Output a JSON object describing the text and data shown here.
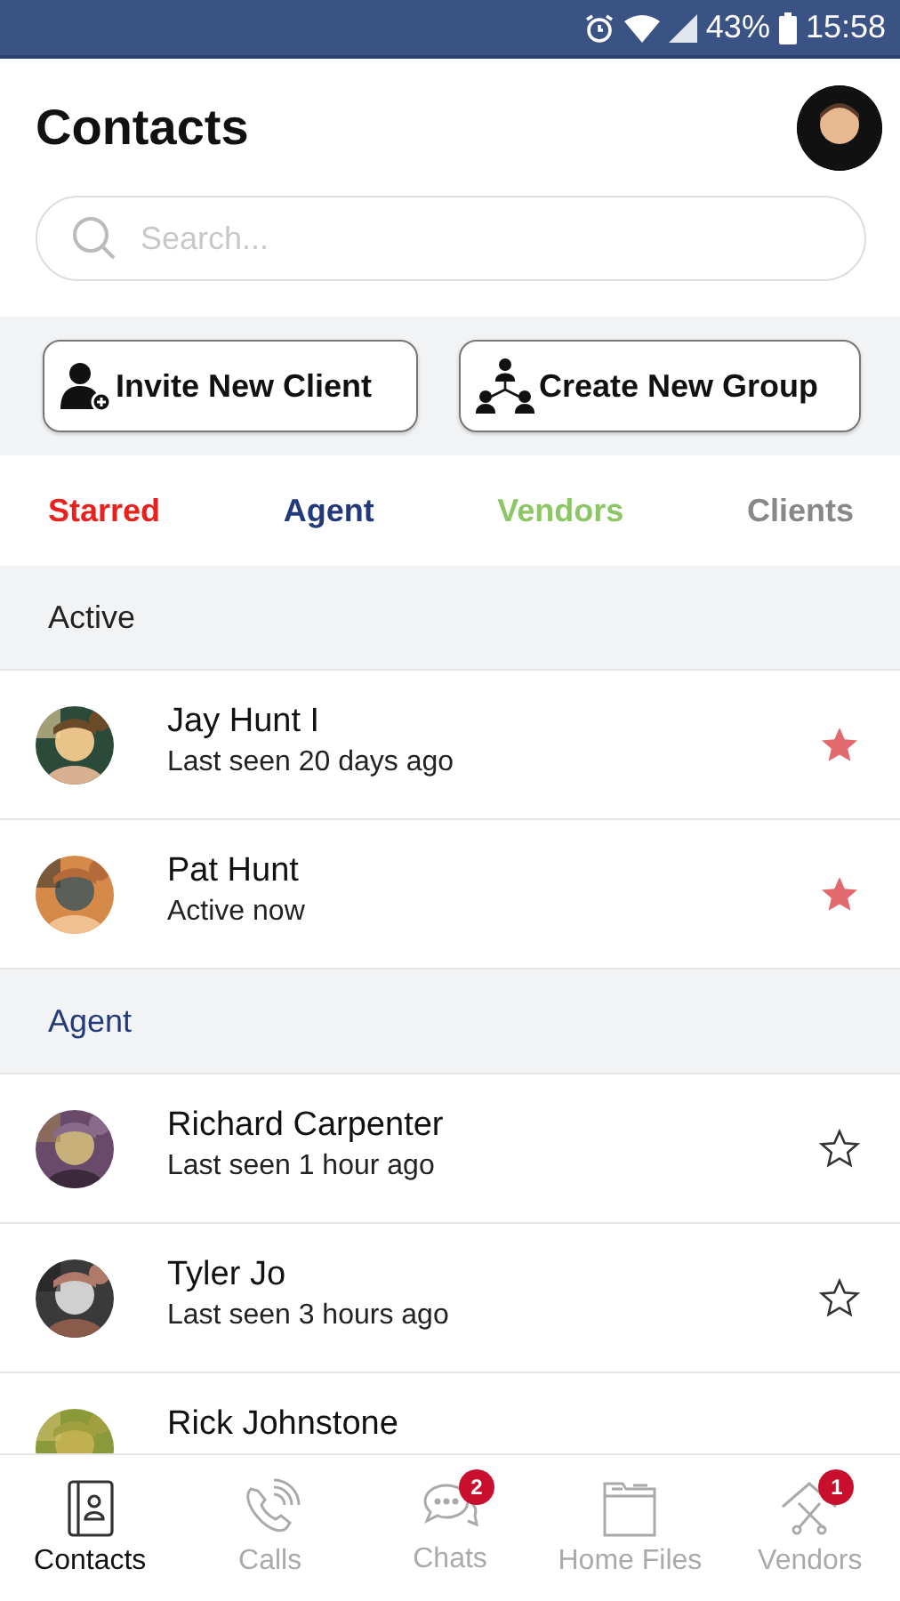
{
  "status_bar": {
    "battery": "43%",
    "time": "15:58"
  },
  "header": {
    "title": "Contacts"
  },
  "search": {
    "placeholder": "Search..."
  },
  "actions": [
    {
      "label": "Invite New Client",
      "kind": "invite"
    },
    {
      "label": "Create New Group",
      "kind": "group"
    }
  ],
  "categories": [
    {
      "label": "Starred",
      "color": "#e8211d"
    },
    {
      "label": "Agent",
      "color": "#233a7a"
    },
    {
      "label": "Vendors",
      "color": "#8cc665"
    },
    {
      "label": "Clients",
      "color": "#888888"
    }
  ],
  "sections": [
    {
      "title": "Active",
      "kind": "plain",
      "contacts": [
        {
          "name": "Jay Hunt I",
          "status": "Last seen 20 days ago",
          "starred": true
        },
        {
          "name": "Pat Hunt",
          "status": "Active now",
          "starred": true
        }
      ]
    },
    {
      "title": "Agent",
      "kind": "agent",
      "contacts": [
        {
          "name": "Richard Carpenter",
          "status": "Last seen 1 hour ago",
          "starred": false
        },
        {
          "name": "Tyler Jo",
          "status": "Last seen 3 hours ago",
          "starred": false
        },
        {
          "name": "Rick Johnstone"
        }
      ]
    }
  ],
  "bottom_nav": [
    {
      "label": "Contacts",
      "kind": "contacts",
      "selected": true
    },
    {
      "label": "Calls",
      "kind": "calls",
      "selected": false
    },
    {
      "label": "Chats",
      "kind": "chats",
      "selected": false,
      "badge": "2"
    },
    {
      "label": "Home Files",
      "kind": "files",
      "selected": false
    },
    {
      "label": "Vendors",
      "kind": "vendors",
      "selected": false,
      "badge": "1"
    }
  ]
}
